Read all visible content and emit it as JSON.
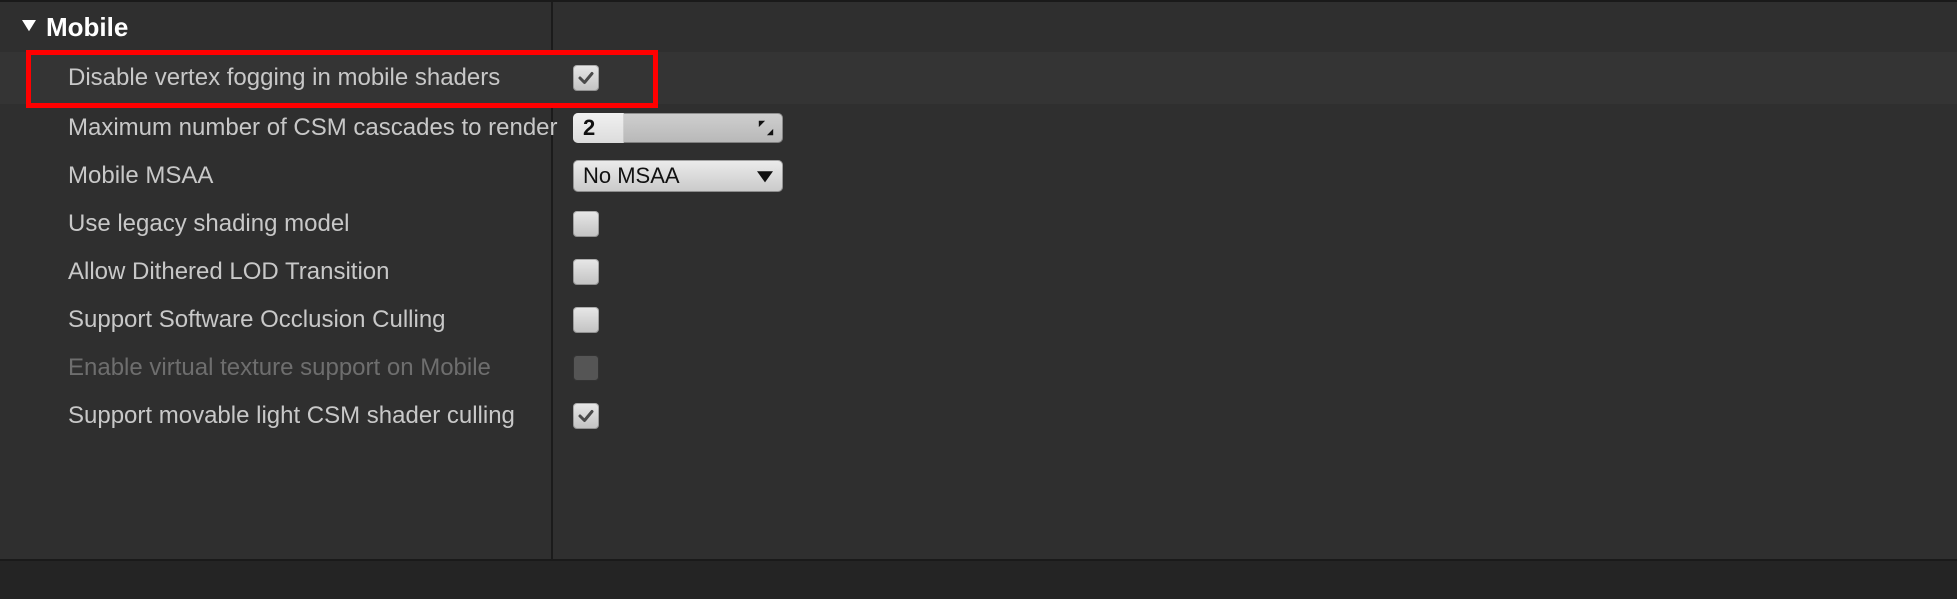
{
  "section": {
    "title": "Mobile"
  },
  "rows": {
    "disable_vertex_fogging": {
      "label": "Disable vertex fogging in mobile shaders",
      "checked": true
    },
    "max_csm_cascades": {
      "label": "Maximum number of CSM cascades to render",
      "value": "2"
    },
    "mobile_msaa": {
      "label": "Mobile MSAA",
      "selected": "No MSAA"
    },
    "legacy_shading": {
      "label": "Use legacy shading model",
      "checked": false
    },
    "dithered_lod": {
      "label": "Allow Dithered LOD Transition",
      "checked": false
    },
    "sw_occlusion": {
      "label": "Support Software Occlusion Culling",
      "checked": false
    },
    "virtual_texture": {
      "label": "Enable virtual texture support on Mobile",
      "checked": false,
      "disabled": true
    },
    "movable_csm_culling": {
      "label": "Support movable light CSM shader culling",
      "checked": true
    }
  },
  "highlight_color": "#ff0000"
}
